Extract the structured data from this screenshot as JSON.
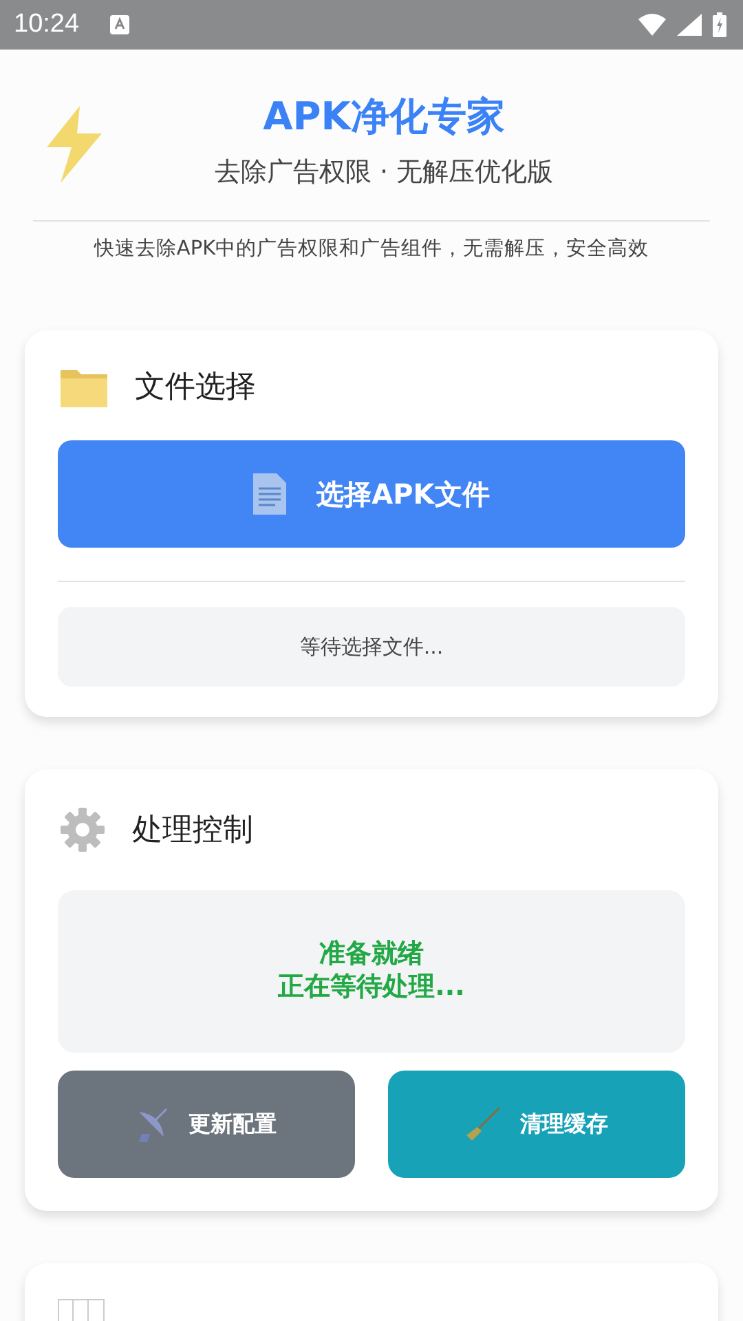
{
  "status_bar": {
    "time": "10:24"
  },
  "header": {
    "title": "APK净化专家",
    "subtitle": "去除广告权限 · 无解压优化版",
    "description": "快速去除APK中的广告权限和广告组件，无需解压，安全高效"
  },
  "file_card": {
    "title": "文件选择",
    "button": "选择APK文件",
    "file_status": "等待选择文件..."
  },
  "process_card": {
    "title": "处理控制",
    "status_lines": [
      "准备就绪",
      "正在等待处理..."
    ],
    "buttons": [
      {
        "kind": "update",
        "label": "更新配置"
      },
      {
        "kind": "clean",
        "label": "清理缓存"
      }
    ]
  }
}
